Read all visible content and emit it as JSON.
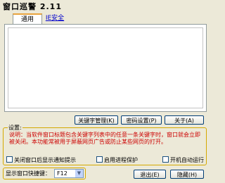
{
  "window": {
    "title": "窗口巡警 2.11"
  },
  "tabs": [
    {
      "label": "通用"
    },
    {
      "label": "IE安全"
    }
  ],
  "buttons": {
    "keyword_manage": "关键字管理(K)",
    "password_settings": "密码设置(P)",
    "about": "关于(A)",
    "exit": "退出(E)",
    "hide": "隐藏(H)"
  },
  "settings": {
    "label": "设置:",
    "description": "说明：当软件窗口标题包含关键字列表中的任意一条关键字时，窗口就会立即被关闭。本功能常被用于屏蔽网页广告或防止某些网页的打开。",
    "options": [
      {
        "label": "关闭窗口后显示通知提示",
        "checked": false
      },
      {
        "label": "启用进程保护",
        "checked": false
      },
      {
        "label": "开机自动运行",
        "checked": false
      }
    ]
  },
  "hotkey": {
    "label": "显示窗口快捷键：",
    "value": "F12"
  }
}
